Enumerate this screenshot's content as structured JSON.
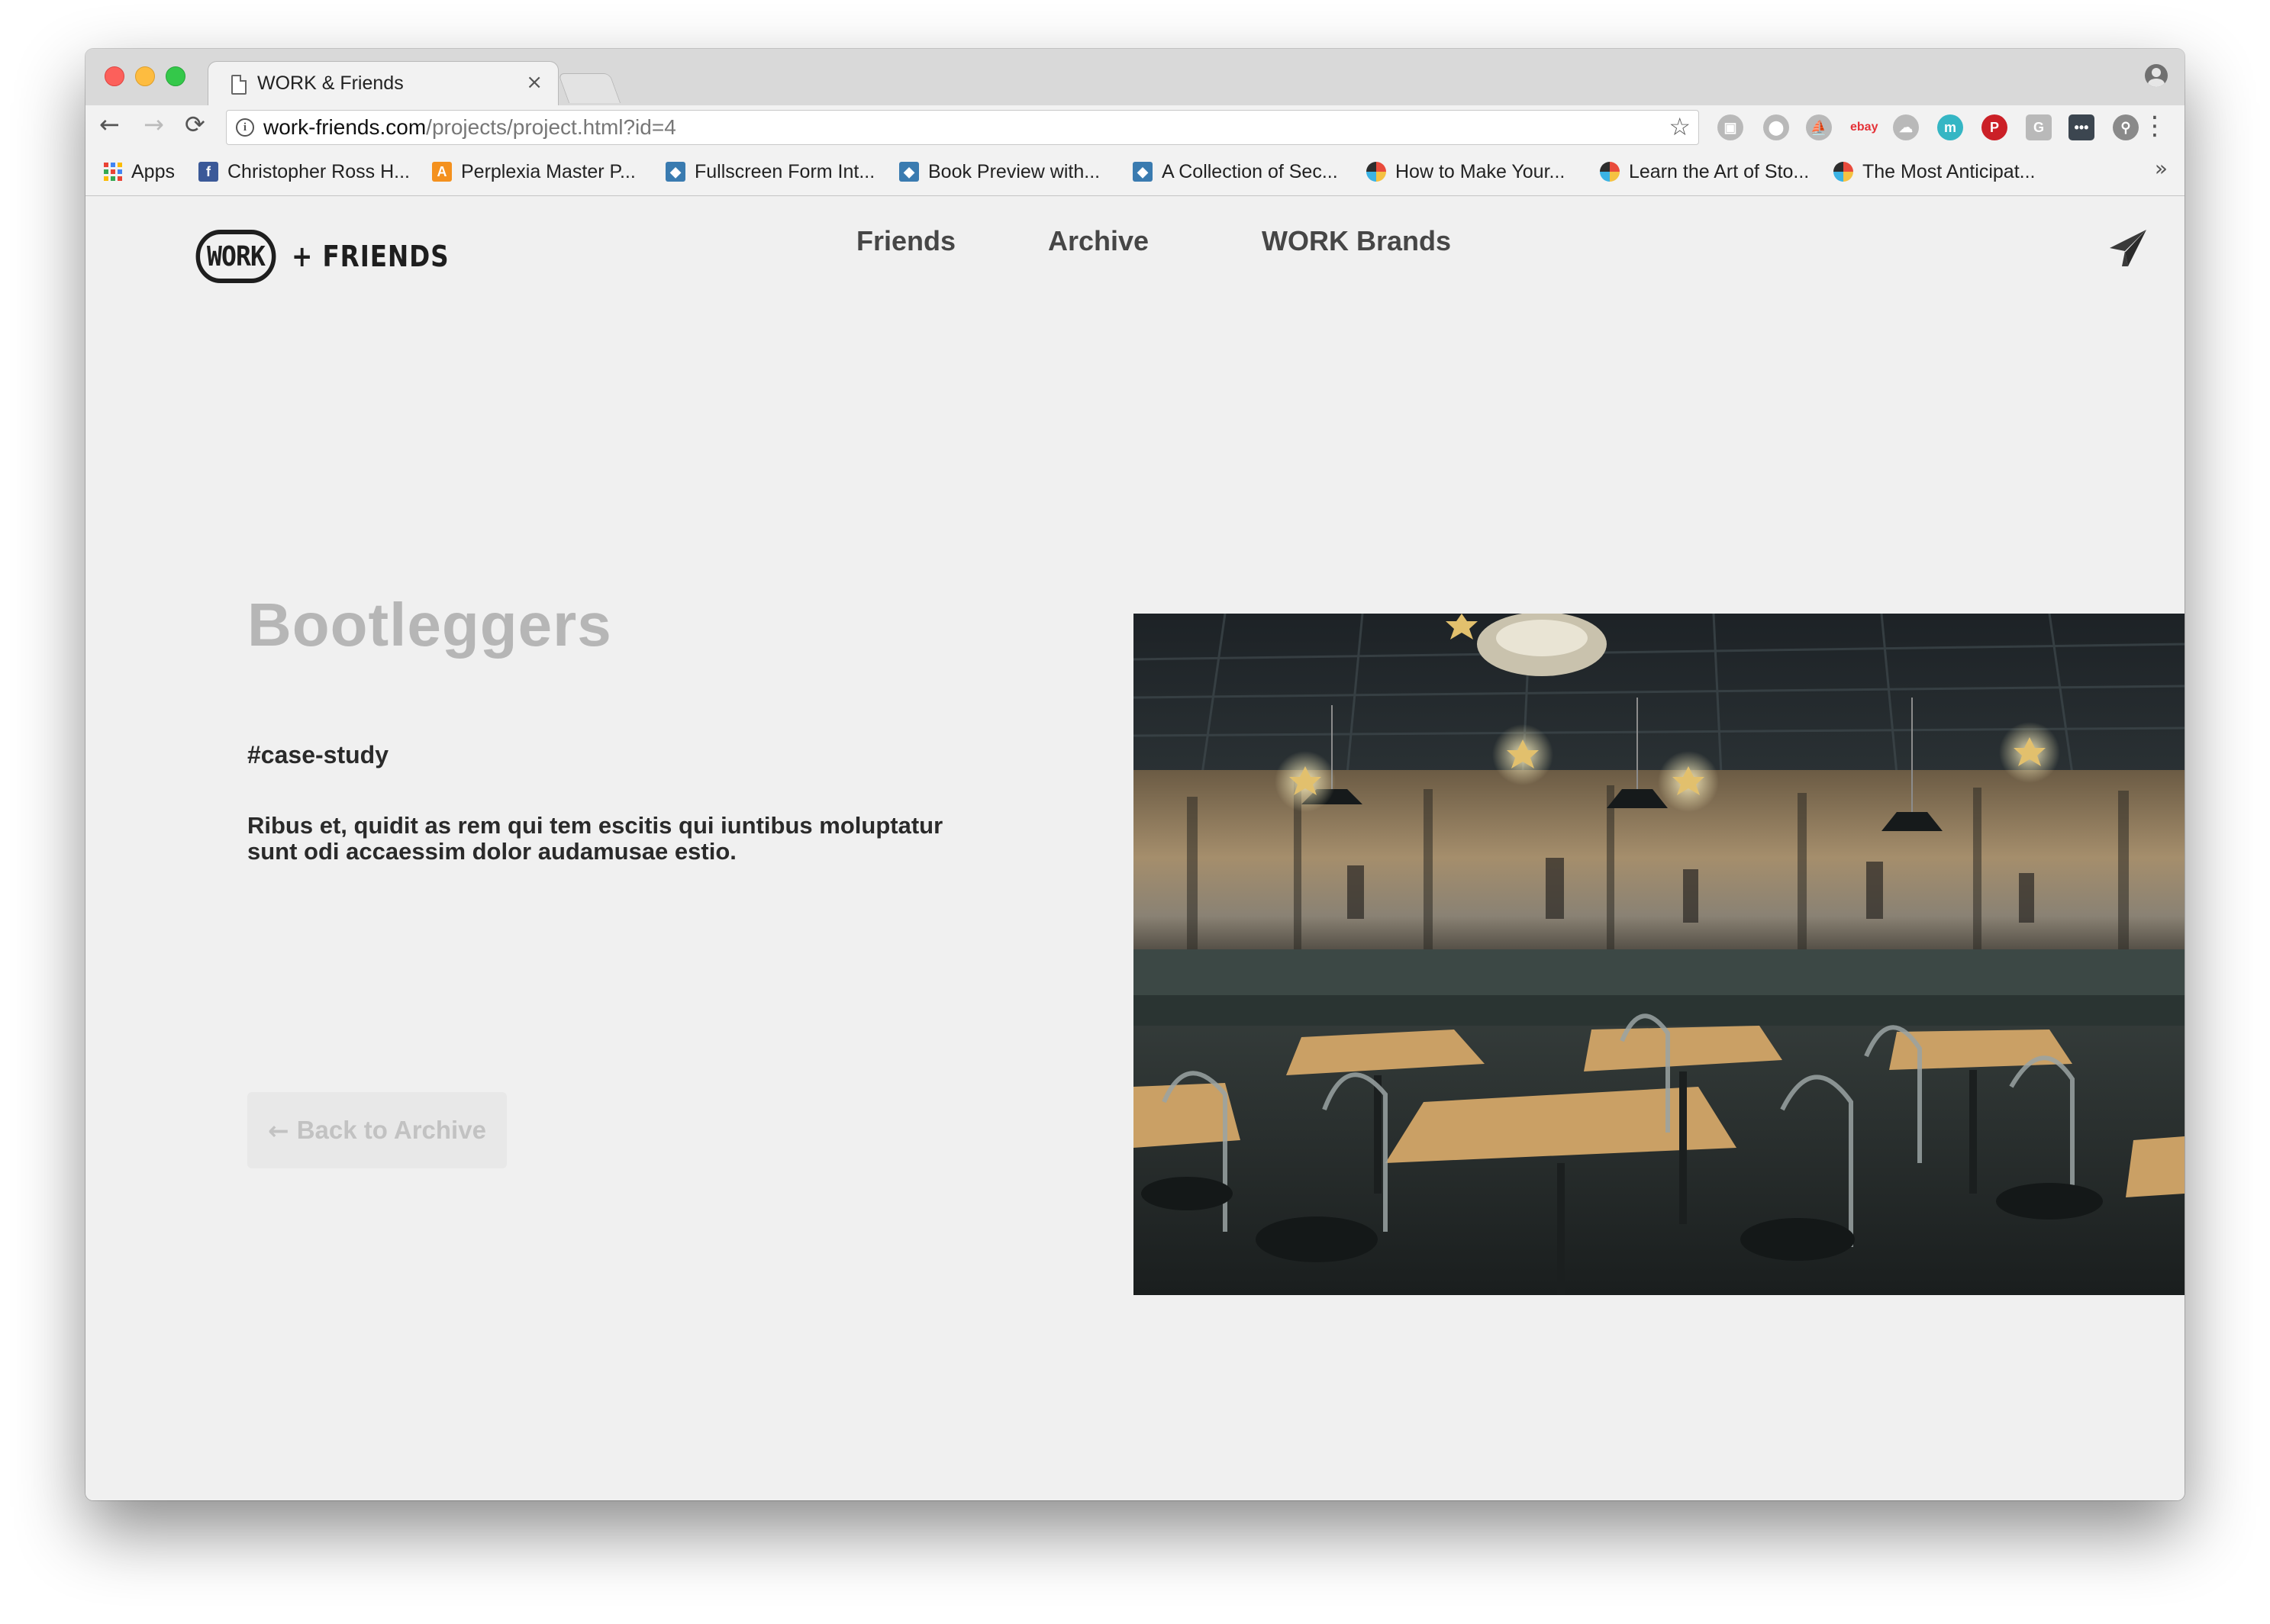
{
  "browser": {
    "tab_title": "WORK & Friends",
    "tab_close": "×",
    "url_host": "work-friends.com",
    "url_path": "/projects/project.html?id=4",
    "bookmarks": [
      {
        "label": "Apps",
        "icon": "apps-grid-icon"
      },
      {
        "label": "Christopher Ross H...",
        "icon": "facebook-icon",
        "color": "#3b5998"
      },
      {
        "label": "Perplexia Master P...",
        "icon": "letter-a-icon",
        "color": "#f4911e"
      },
      {
        "label": "Fullscreen Form Int...",
        "icon": "drop-icon",
        "color": "#3a7bb0"
      },
      {
        "label": "Book Preview with...",
        "icon": "drop-icon",
        "color": "#3a7bb0"
      },
      {
        "label": "A Collection of Sec...",
        "icon": "drop-icon",
        "color": "#3a7bb0"
      },
      {
        "label": "How to Make Your...",
        "icon": "color-circle-icon"
      },
      {
        "label": "Learn the Art of Sto...",
        "icon": "color-circle-icon"
      },
      {
        "label": "The Most Anticipat...",
        "icon": "color-circle-icon"
      }
    ],
    "bookmarks_more": "»",
    "extensions": [
      {
        "name": "screenshot-extension-icon",
        "glyph": "▣",
        "color": "#b9b9b9"
      },
      {
        "name": "location-extension-icon",
        "glyph": "⬤",
        "color": "#b9b9b9"
      },
      {
        "name": "boat-extension-icon",
        "glyph": "⛵",
        "color": "#b9b9b9"
      },
      {
        "name": "ebay-extension-icon",
        "glyph": "ebay",
        "color": "#e53238"
      },
      {
        "name": "cloud-extension-icon",
        "glyph": "☁",
        "color": "#b9b9b9"
      },
      {
        "name": "m-extension-icon",
        "glyph": "m",
        "color": "#35b6c4"
      },
      {
        "name": "pinterest-extension-icon",
        "glyph": "P",
        "color": "#cb2027"
      },
      {
        "name": "grammarly-extension-icon",
        "glyph": "G",
        "color": "#b9b9b9"
      },
      {
        "name": "lastpass-extension-icon",
        "glyph": "•••",
        "color": "#3c4650"
      },
      {
        "name": "link-extension-icon",
        "glyph": "⚲",
        "color": "#8a8a8a"
      }
    ]
  },
  "site": {
    "logo_work": "WORK",
    "logo_friends": "+ FRIENDS",
    "nav": [
      {
        "label": "Friends"
      },
      {
        "label": "Archive"
      },
      {
        "label": "WORK Brands"
      }
    ]
  },
  "project": {
    "title": "Bootleggers",
    "tag": "#case-study",
    "description": "Ribus et, quidit as rem qui tem escitis qui iuntibus moluptatur sunt odi accaessim dolor audamusae estio.",
    "back_arrow": "←",
    "back_label": "Back to Archive",
    "image_subject": "restaurant-interior-photo"
  }
}
